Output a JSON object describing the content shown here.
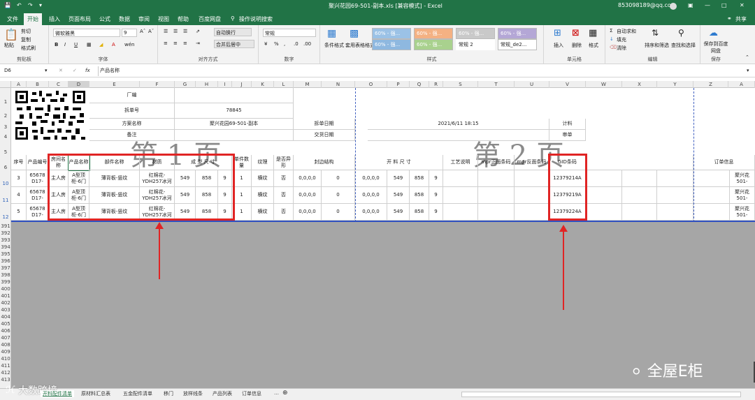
{
  "titlebar": {
    "filename": "聚兴花园69-501-副本.xls  [兼容模式]  -  Excel",
    "account": "853098189@qq.com",
    "save_label": "S"
  },
  "tabs": [
    "文件",
    "开始",
    "插入",
    "页面布局",
    "公式",
    "数据",
    "审阅",
    "视图",
    "帮助",
    "百度网盘",
    "操作说明搜索"
  ],
  "share_label": "共享",
  "ribbon": {
    "clipboard": {
      "paste": "粘贴",
      "cut": "剪切",
      "copy": "复制",
      "format_painter": "格式刷",
      "label": "剪贴板"
    },
    "font": {
      "name": "微软雅黑",
      "size": "9",
      "label": "字体"
    },
    "alignment": {
      "wrap": "自动换行",
      "merge": "合并后居中",
      "label": "对齐方式"
    },
    "number": {
      "format": "常规",
      "label": "数字"
    },
    "styles": {
      "conditional": "条件格式",
      "table": "套用表格格式",
      "items": [
        "60% - 强...",
        "60% - 强...",
        "60% - 强...",
        "60% - 强...",
        "60% - 强...",
        "60% - 强...",
        "常规 2",
        "常规_de2..."
      ],
      "label": "样式"
    },
    "cells": {
      "insert": "插入",
      "delete": "删除",
      "format": "格式",
      "label": "单元格"
    },
    "editing": {
      "autosum": "自动求和",
      "fill": "填充",
      "clear": "清除",
      "sort": "排序和筛选",
      "find": "查找和选择",
      "label": "编辑"
    },
    "save": {
      "baidu": "保存到百度网盘",
      "label": "保存"
    }
  },
  "formula_bar": {
    "name_box": "D6",
    "fx": "fx",
    "content": "产品名称"
  },
  "columns": [
    "A",
    "B",
    "C",
    "D",
    "E",
    "F",
    "G",
    "H",
    "I",
    "J",
    "K",
    "L",
    "M",
    "N",
    "O",
    "P",
    "Q",
    "R",
    "S",
    "T",
    "U",
    "V",
    "W",
    "X",
    "Y",
    "Z",
    "A"
  ],
  "rows": [
    "1",
    "2",
    "3",
    "4",
    "5",
    "6",
    "10",
    "11",
    "12",
    "391",
    "392",
    "393",
    "394",
    "395",
    "396",
    "397",
    "398",
    "399",
    "400",
    "401",
    "402",
    "403",
    "404",
    "405",
    "406",
    "407",
    "408",
    "409",
    "410",
    "411",
    "412",
    "413"
  ],
  "header": {
    "factory": "厂编",
    "order_no_label": "拆单号",
    "order_no": "78845",
    "plan_label": "方案名称",
    "plan": "聚兴花园69-501-副本",
    "note_label": "备注",
    "split_date_label": "拆单日期",
    "split_date": "2021/6/11 18:15",
    "delivery_label": "交货日期",
    "count_label": "计料",
    "audit_label": "审单"
  },
  "page_marks": {
    "page1": "第 1 页",
    "page2": "第 2 页"
  },
  "table_headers": {
    "seq": "序号",
    "product_no": "产品编号",
    "room": "房间名称",
    "product_name": "产品名称",
    "part_name": "部件名称",
    "material": "材质",
    "size": "成 型 尺 寸",
    "qty": "单件数量",
    "texture": "纹理",
    "special": "是否异形",
    "edge": "封边结构",
    "cut_size": "开 料 尺 寸",
    "process": "工艺说明",
    "mpr_front": "mpr正面条码",
    "mpr_back": "mpr反面条码",
    "barcode": "GID条码",
    "order_info": "订单信息"
  },
  "data_rows": [
    {
      "seq": "3",
      "product_no": "65678 D17-",
      "room": "主人房",
      "product_name": "A型顶柜-6门",
      "part_name": "薄背板-竖纹",
      "material": "红棉花-YDH257冰河",
      "l": "549",
      "w": "858",
      "t": "9",
      "qty": "1",
      "texture": "横纹",
      "special": "否",
      "edge": "0,0,0,0",
      "edge_n": "0",
      "cut_edge": "0,0,0,0",
      "cl": "549",
      "cw": "858",
      "ct": "9",
      "barcode": "12379214A",
      "order": "聚兴花 501-"
    },
    {
      "seq": "4",
      "product_no": "65678 D17-",
      "room": "主人房",
      "product_name": "A型顶柜-6门",
      "part_name": "薄背板-竖纹",
      "material": "红棉花-YDH257冰河",
      "l": "549",
      "w": "858",
      "t": "9",
      "qty": "1",
      "texture": "横纹",
      "special": "否",
      "edge": "0,0,0,0",
      "edge_n": "0",
      "cut_edge": "0,0,0,0",
      "cl": "549",
      "cw": "858",
      "ct": "9",
      "barcode": "12379219A",
      "order": "聚兴花 501-"
    },
    {
      "seq": "5",
      "product_no": "65678 D17-",
      "room": "主人房",
      "product_name": "A型顶柜-6门",
      "part_name": "薄背板-竖纹",
      "material": "红棉花-YDH257冰河",
      "l": "549",
      "w": "858",
      "t": "9",
      "qty": "1",
      "texture": "横纹",
      "special": "否",
      "edge": "0,0,0,0",
      "edge_n": "0",
      "cut_edge": "0,0,0,0",
      "cl": "549",
      "cw": "858",
      "ct": "9",
      "barcode": "12379224A",
      "order": "聚兴花 501-"
    }
  ],
  "sheet_tabs": [
    "开料配件清单",
    "原材料汇总表",
    "五金配件清单",
    "移门",
    "放样线条",
    "产品列表",
    "订单信息"
  ],
  "watermarks": {
    "left": "大数跨境",
    "right": "全屋E柜"
  }
}
